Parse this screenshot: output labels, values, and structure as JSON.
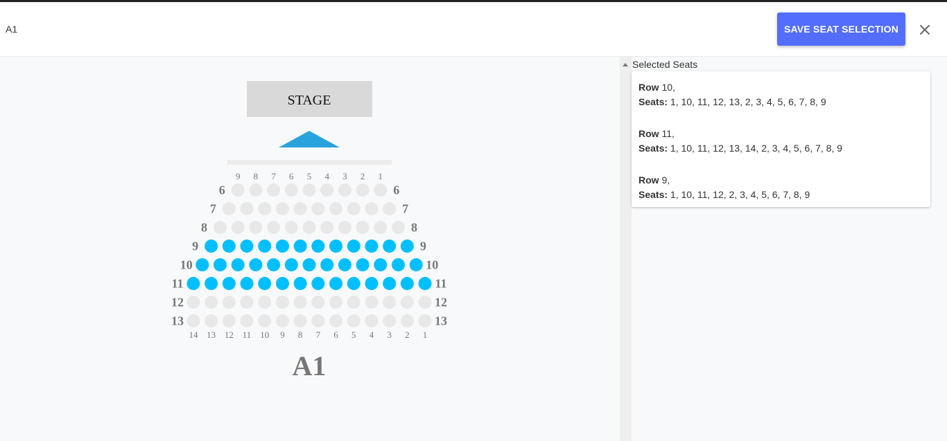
{
  "header": {
    "title": "A1",
    "save_label": "SAVE SEAT SELECTION"
  },
  "colors": {
    "accent": "#536dfe",
    "seat_selected": "#00bfff",
    "seat_empty": "#e8e8e8",
    "stage_arrow": "#29a3dc"
  },
  "icons": {
    "close": "close-icon",
    "collapse": "caret-up-icon"
  },
  "seatmap": {
    "stage_label": "STAGE",
    "section_label": "A1",
    "top_numbers": [
      "9",
      "8",
      "7",
      "6",
      "5",
      "4",
      "3",
      "2",
      "1"
    ],
    "bottom_numbers": [
      "14",
      "13",
      "12",
      "11",
      "10",
      "9",
      "8",
      "7",
      "6",
      "5",
      "4",
      "3",
      "2",
      "1"
    ],
    "rows": [
      {
        "label": "6",
        "seats": 9,
        "selected": false
      },
      {
        "label": "7",
        "seats": 10,
        "selected": false
      },
      {
        "label": "8",
        "seats": 11,
        "selected": false
      },
      {
        "label": "9",
        "seats": 12,
        "selected": true
      },
      {
        "label": "10",
        "seats": 13,
        "selected": true
      },
      {
        "label": "11",
        "seats": 14,
        "selected": true
      },
      {
        "label": "12",
        "seats": 14,
        "selected": false
      },
      {
        "label": "13",
        "seats": 14,
        "selected": false
      }
    ]
  },
  "selected_panel": {
    "title": "Selected Seats",
    "row_key": "Row",
    "seats_key": "Seats:",
    "entries": [
      {
        "row": "10,",
        "seats": "1, 10, 11, 12, 13, 2, 3, 4, 5, 6, 7, 8, 9"
      },
      {
        "row": "11,",
        "seats": "1, 10, 11, 12, 13, 14, 2, 3, 4, 5, 6, 7, 8, 9"
      },
      {
        "row": "9,",
        "seats": "1, 10, 11, 12, 2, 3, 4, 5, 6, 7, 8, 9"
      }
    ]
  }
}
